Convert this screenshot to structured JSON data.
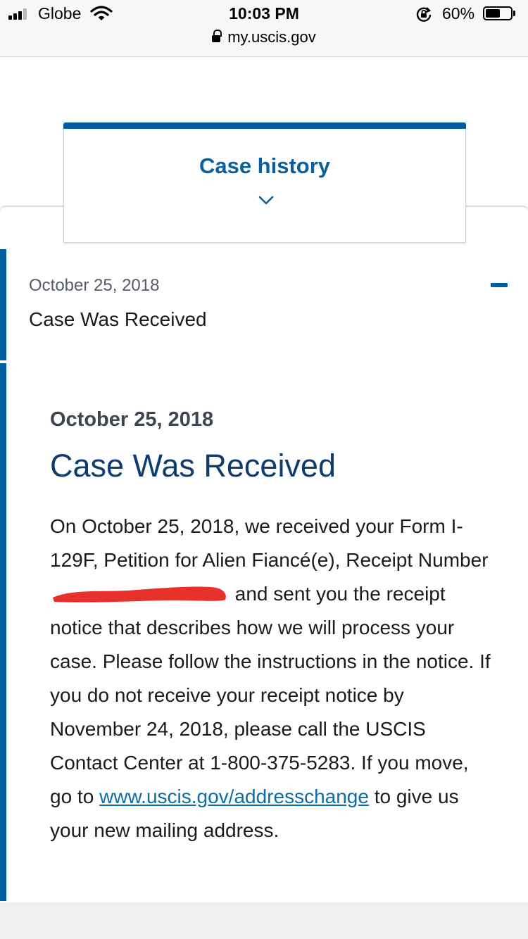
{
  "status_bar": {
    "carrier": "Globe",
    "time": "10:03 PM",
    "url": "my.uscis.gov",
    "battery_percent": "60%",
    "battery_level": 0.6,
    "icons": [
      "signal-icon",
      "wifi-icon",
      "lock-icon",
      "rotation-lock-icon",
      "battery-icon"
    ]
  },
  "tab": {
    "title": "Case history",
    "icon": "chevron-down-icon"
  },
  "history": {
    "items": [
      {
        "date": "October 25, 2018",
        "status": "Case Was Received",
        "icon": "collapse-icon"
      }
    ]
  },
  "detail": {
    "date": "October 25, 2018",
    "title": "Case Was Received",
    "body_1": "On October 25, 2018, we received your Form I-129F, Petition for Alien Fiancé(e), Receipt Number",
    "body_2": "and sent you the receipt notice that describes how we will process your case. Please follow the instructions in the notice. If you do not receive your receipt notice by November 24, 2018, please call the USCIS Contact Center at 1-800-375-5283. If you move, go to",
    "link_text": "www.uscis.gov/addresschange",
    "body_3": "to give us your new mailing address."
  },
  "colors": {
    "accent": "#005ea2",
    "title": "#0e3c6e",
    "link": "#0a6fa8",
    "redaction": "#e8312a"
  }
}
